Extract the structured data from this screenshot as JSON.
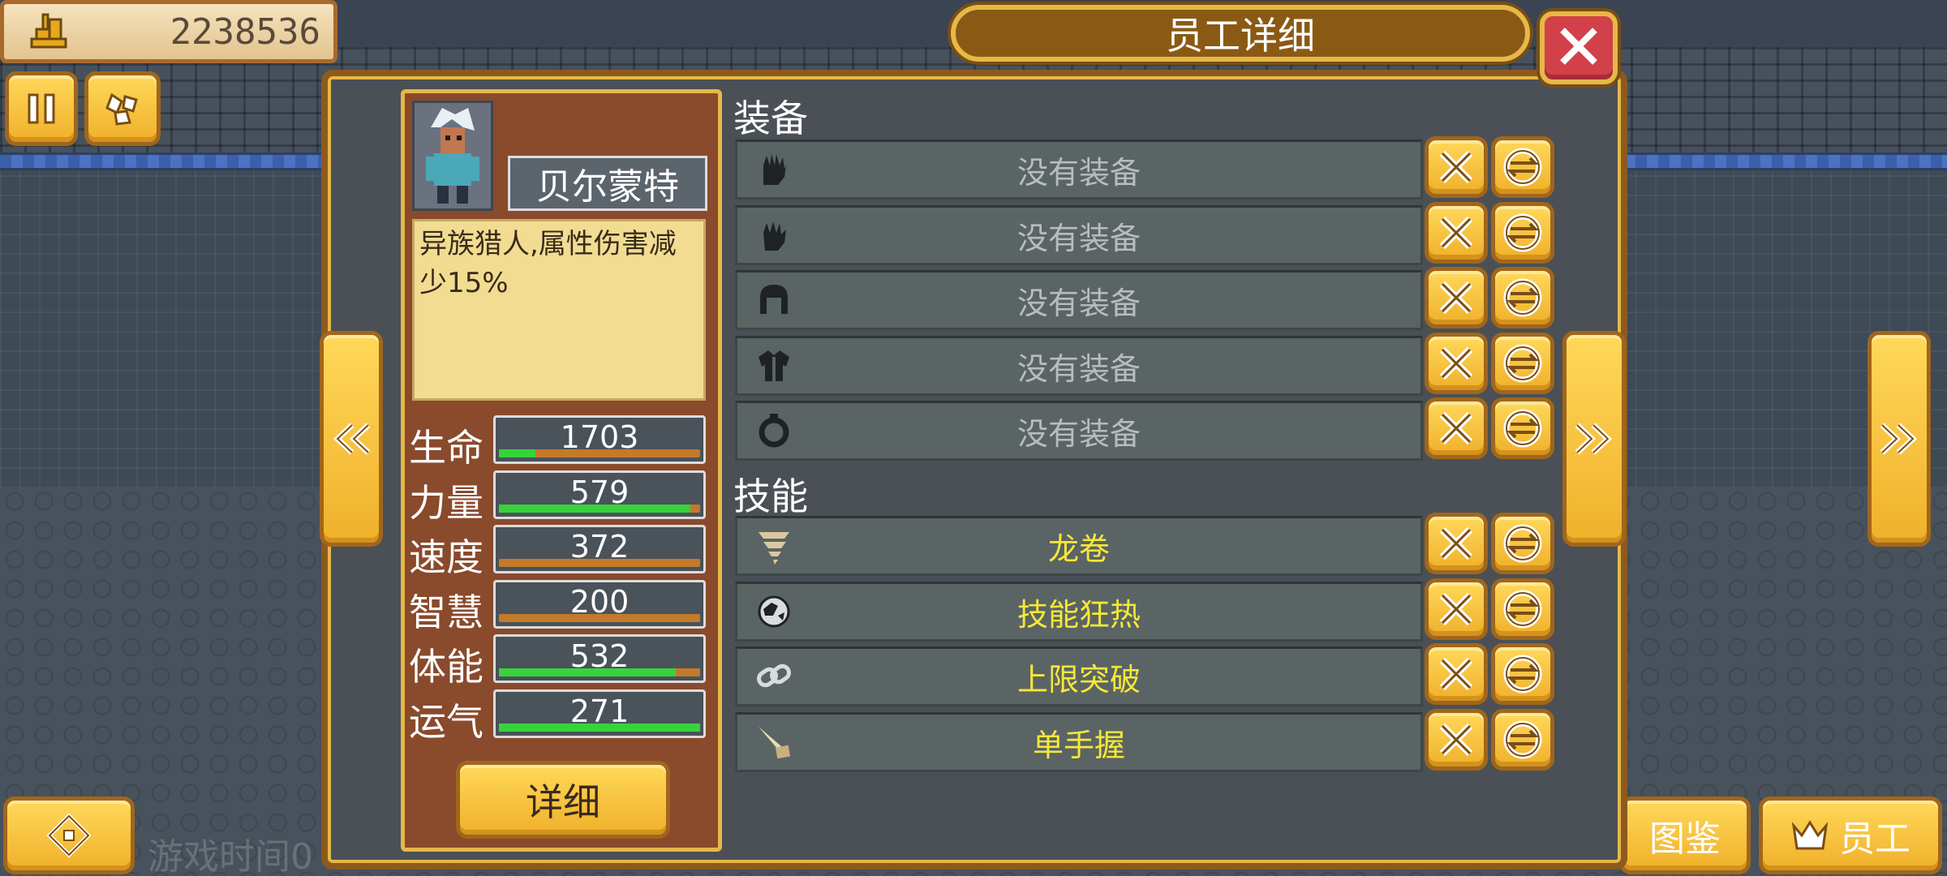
{
  "hud": {
    "money_value": "2238536",
    "money_icon": "gold-coins-icon",
    "game_time_label": "游戏时间0"
  },
  "dialog": {
    "title": "员工详细"
  },
  "character": {
    "name": "贝尔蒙特",
    "description": "异族猎人,属性伤害减少15%",
    "stats": [
      {
        "label": "生命",
        "value": "1703",
        "fill": 0.18
      },
      {
        "label": "力量",
        "value": "579",
        "fill": 0.95
      },
      {
        "label": "速度",
        "value": "372",
        "fill": 0.0
      },
      {
        "label": "智慧",
        "value": "200",
        "fill": 0.0
      },
      {
        "label": "体能",
        "value": "532",
        "fill": 0.88
      },
      {
        "label": "运气",
        "value": "271",
        "fill": 1.0
      }
    ],
    "detail_button": "详细"
  },
  "equipment": {
    "title": "装备",
    "slots": [
      {
        "icon": "glove-icon",
        "text": "没有装备"
      },
      {
        "icon": "gauntlet-icon",
        "text": "没有装备"
      },
      {
        "icon": "helmet-icon",
        "text": "没有装备"
      },
      {
        "icon": "armor-icon",
        "text": "没有装备"
      },
      {
        "icon": "ring-icon",
        "text": "没有装备"
      }
    ]
  },
  "skills": {
    "title": "技能",
    "items": [
      {
        "icon": "tornado-icon",
        "text": "龙卷"
      },
      {
        "icon": "globe-icon",
        "text": "技能狂热"
      },
      {
        "icon": "chain-link-icon",
        "text": "上限突破"
      },
      {
        "icon": "sword-hand-icon",
        "text": "单手握"
      }
    ]
  },
  "bottom_right": {
    "encyclopedia_label": "图鉴",
    "staff_label": "员工"
  },
  "colors": {
    "gold": "#f0b02a",
    "panel_brown": "#8a4a2c",
    "close_red": "#d2404a",
    "skill_yellow": "#f4e838",
    "stat_green": "#36d43a"
  }
}
